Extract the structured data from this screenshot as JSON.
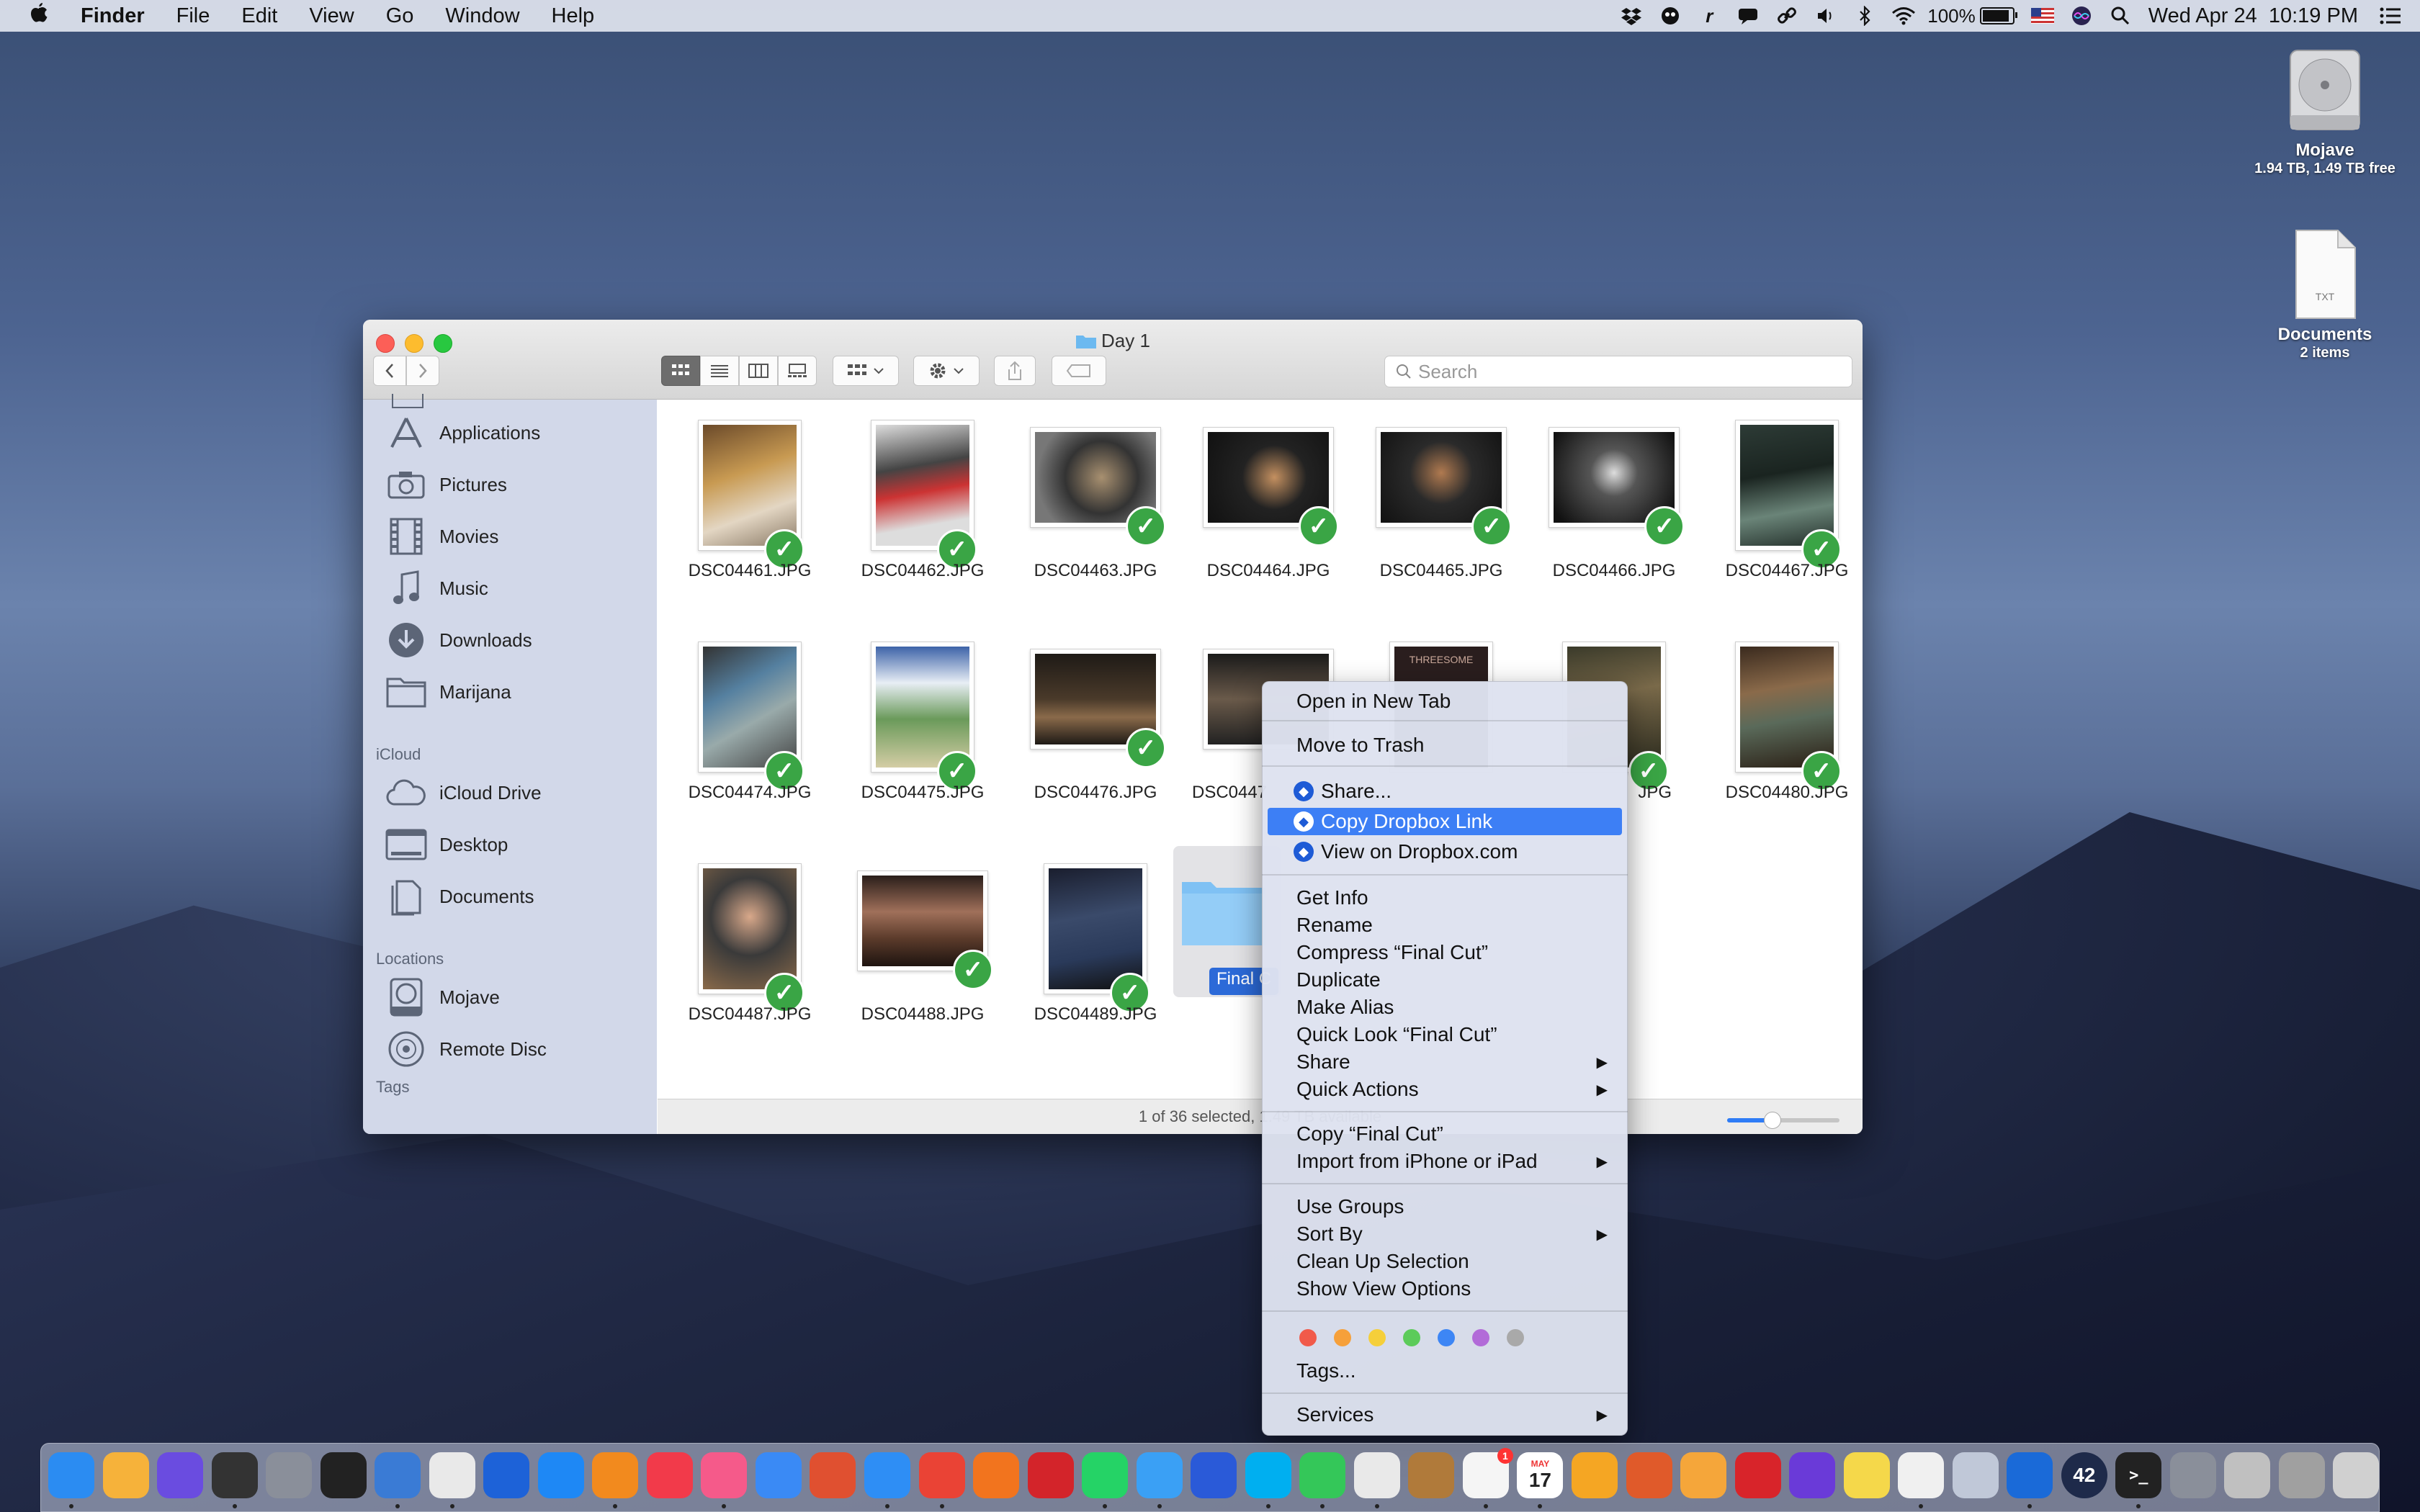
{
  "menubar": {
    "apple": "",
    "app": "Finder",
    "menus": [
      "File",
      "Edit",
      "View",
      "Go",
      "Window",
      "Help"
    ],
    "battery": "100%",
    "clock": "Wed Apr 24  10:19 PM"
  },
  "desktop": {
    "disk": {
      "name": "Mojave",
      "info": "1.94 TB, 1.49 TB free"
    },
    "doc": {
      "name": "Documents",
      "info": "2 items",
      "badge": "TXT"
    }
  },
  "window": {
    "title": "Day 1",
    "search_placeholder": "Search",
    "status": "1 of 36 selected, 1.49 TB available",
    "zoom_level": 0.4
  },
  "sidebar": {
    "favorites": [
      "Applications",
      "Pictures",
      "Movies",
      "Music",
      "Downloads",
      "Marijana"
    ],
    "icloud_header": "iCloud",
    "icloud": [
      "iCloud Drive",
      "Desktop",
      "Documents"
    ],
    "locations_header": "Locations",
    "locations": [
      "Mojave",
      "Remote Disc"
    ],
    "tags_header": "Tags"
  },
  "files": [
    "DSC04461.JPG",
    "DSC04462.JPG",
    "DSC04463.JPG",
    "DSC04464.JPG",
    "DSC04465.JPG",
    "DSC04466.JPG",
    "DSC04467.JPG",
    "DSC04474.JPG",
    "DSC04475.JPG",
    "DSC04476.JPG",
    "DSC0447",
    "",
    "JPG",
    "DSC04480.JPG",
    "DSC04487.JPG",
    "DSC04488.JPG",
    "DSC04489.JPG"
  ],
  "selected_folder_label": "Final C",
  "thumb_texts": {
    "threesome": "THREESOME"
  },
  "context_menu": {
    "open_new_tab": "Open in New Tab",
    "move_to_trash": "Move to Trash",
    "share_db": "Share...",
    "copy_db_link": "Copy Dropbox Link",
    "view_db": "View on Dropbox.com",
    "get_info": "Get Info",
    "rename": "Rename",
    "compress": "Compress “Final Cut”",
    "duplicate": "Duplicate",
    "make_alias": "Make Alias",
    "quick_look": "Quick Look “Final Cut”",
    "share": "Share",
    "quick_actions": "Quick Actions",
    "copy": "Copy “Final Cut”",
    "import": "Import from iPhone or iPad",
    "use_groups": "Use Groups",
    "sort_by": "Sort By",
    "clean_up": "Clean Up Selection",
    "show_view_options": "Show View Options",
    "tags": "Tags...",
    "services": "Services",
    "tag_colors": [
      "#f15a4a",
      "#f6a03a",
      "#f5cf3a",
      "#5ccb5a",
      "#3d86f5",
      "#b26bd8",
      "#a9a9a9"
    ]
  },
  "dock": {
    "calendar_month": "MAY",
    "calendar_day": "17",
    "app_42": "42",
    "badge_count": "1",
    "icons": [
      "finder-icon",
      "home-icon",
      "siri-icon",
      "dashboard-icon",
      "launchpad-icon",
      "activity-monitor-icon",
      "app-icon",
      "preview-icon",
      "dropbox-icon",
      "app-store-icon",
      "books-icon",
      "news-icon",
      "itunes-icon",
      "testflight-icon",
      "maps-icon",
      "safari-icon",
      "chrome-icon",
      "firefox-icon",
      "opera-icon",
      "whatsapp-icon",
      "messages-icon",
      "tweetbot-icon",
      "skype-icon",
      "facetime-icon",
      "slack-icon",
      "notefile-icon",
      "reminders-icon",
      "calendar-icon",
      "photos-icon",
      "pixelmator-icon",
      "pages-icon",
      "creative-cloud-icon",
      "imovie-icon",
      "notes-icon",
      "textedit-icon",
      "screenshot-icon",
      "1password-icon",
      "app-42-icon",
      "terminal-icon",
      "system-prefs-icon",
      "disk-utility-icon",
      "archive-icon",
      "trash-icon"
    ]
  }
}
